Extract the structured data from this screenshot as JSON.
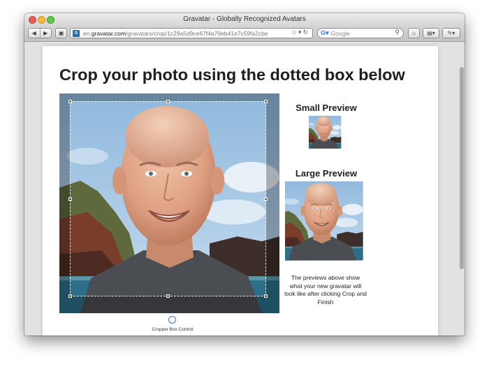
{
  "window": {
    "title": "Gravatar - Globally Recognized Avatars"
  },
  "toolbar": {
    "url_prefix": "en.",
    "url_domain": "gravatar.com",
    "url_path": "/gravatars/crop/1c29a5d9ce67f4a79eb41e7c59fa2cbe",
    "search_placeholder": "Google"
  },
  "page": {
    "heading": "Crop your photo using the dotted box below",
    "small_preview_title": "Small Preview",
    "large_preview_title": "Large Preview",
    "preview_note": "The previews above show what your new gravatar will look like after clicking Crop and Finish",
    "cropper_control_label": "Cropper Box Control"
  },
  "colors": {
    "accent": "#3a77c2",
    "heading": "#1f1f1f"
  },
  "icons": {
    "back": "back-arrow-icon",
    "forward": "forward-arrow-icon",
    "reader": "reader-icon",
    "favicon": "gravatar-favicon",
    "bookmark": "star-icon",
    "reload": "reload-icon",
    "search": "magnifier-icon",
    "home": "home-icon",
    "tabs": "tab-view-icon",
    "extensions": "extensions-icon"
  }
}
